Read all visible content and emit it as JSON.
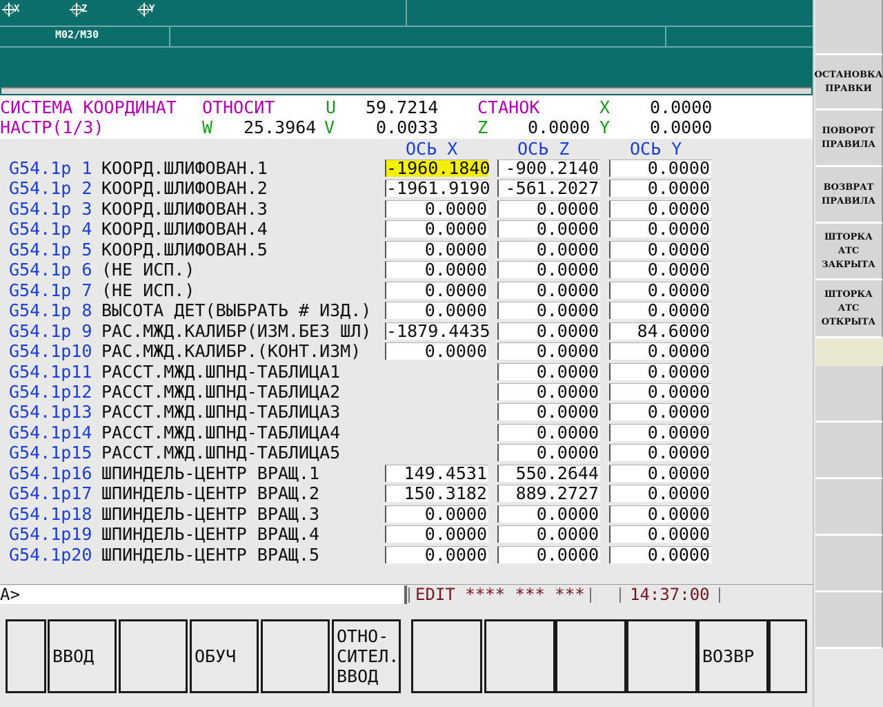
{
  "top": {
    "axes": [
      "X",
      "Z",
      "Y"
    ],
    "mcode": "M02/M30"
  },
  "header": {
    "line1": {
      "title": "СИСТЕМА КООРДИНАТ",
      "mode": "ОТНОСИТ",
      "u_label": "U",
      "u_value": "59.7214",
      "machine_label": "СТАНОК",
      "x_label": "X",
      "x_value": "0.0000"
    },
    "line2": {
      "page": "НАСТР(1/3)",
      "w_label": "W",
      "w_value": "25.3964",
      "v_label": "V",
      "v_value": "0.0033",
      "z_label": "Z",
      "z_value": "0.0000",
      "y_label": "Y",
      "y_value": "0.0000"
    }
  },
  "table": {
    "columns": [
      "ОСЬ X",
      "ОСЬ Z",
      "ОСЬ Y"
    ],
    "rows": [
      {
        "id": "G54.1p 1",
        "name": "КООРД.ШЛИФОВАН.1",
        "x": "-1960.1840",
        "z": "-900.2140",
        "y": "0.0000"
      },
      {
        "id": "G54.1p 2",
        "name": "КООРД.ШЛИФОВАН.2",
        "x": "-1961.9190",
        "z": "-561.2027",
        "y": "0.0000"
      },
      {
        "id": "G54.1p 3",
        "name": "КООРД.ШЛИФОВАН.3",
        "x": "0.0000",
        "z": "0.0000",
        "y": "0.0000"
      },
      {
        "id": "G54.1p 4",
        "name": "КООРД.ШЛИФОВАН.4",
        "x": "0.0000",
        "z": "0.0000",
        "y": "0.0000"
      },
      {
        "id": "G54.1p 5",
        "name": "КООРД.ШЛИФОВАН.5",
        "x": "0.0000",
        "z": "0.0000",
        "y": "0.0000"
      },
      {
        "id": "G54.1p 6",
        "name": "(НЕ ИСП.)",
        "x": "0.0000",
        "z": "0.0000",
        "y": "0.0000"
      },
      {
        "id": "G54.1p 7",
        "name": "(НЕ ИСП.)",
        "x": "0.0000",
        "z": "0.0000",
        "y": "0.0000"
      },
      {
        "id": "G54.1p 8",
        "name": "ВЫСОТА ДЕТ(ВЫБРАТЬ # ИЗД.)",
        "x": "0.0000",
        "z": "0.0000",
        "y": "0.0000"
      },
      {
        "id": "G54.1p 9",
        "name": "РАС.МЖД.КАЛИБР(ИЗМ.БЕЗ ШЛ)",
        "x": "-1879.4435",
        "z": "0.0000",
        "y": "84.6000"
      },
      {
        "id": "G54.1p10",
        "name": "РАС.МЖД.КАЛИБР.(КОНТ.ИЗМ)",
        "x": "0.0000",
        "z": "0.0000",
        "y": "0.0000"
      },
      {
        "id": "G54.1p11",
        "name": "РАССТ.МЖД.ШПНД-ТАБЛИЦА1",
        "x": null,
        "z": "0.0000",
        "y": "0.0000"
      },
      {
        "id": "G54.1p12",
        "name": "РАССТ.МЖД.ШПНД-ТАБЛИЦА2",
        "x": null,
        "z": "0.0000",
        "y": "0.0000"
      },
      {
        "id": "G54.1p13",
        "name": "РАССТ.МЖД.ШПНД-ТАБЛИЦА3",
        "x": null,
        "z": "0.0000",
        "y": "0.0000"
      },
      {
        "id": "G54.1p14",
        "name": "РАССТ.МЖД.ШПНД-ТАБЛИЦА4",
        "x": null,
        "z": "0.0000",
        "y": "0.0000"
      },
      {
        "id": "G54.1p15",
        "name": "РАССТ.МЖД.ШПНД-ТАБЛИЦА5",
        "x": null,
        "z": "0.0000",
        "y": "0.0000"
      },
      {
        "id": "G54.1p16",
        "name": "ШПИНДЕЛЬ-ЦЕНТР ВРАЩ.1",
        "x": "149.4531",
        "z": "550.2644",
        "y": "0.0000"
      },
      {
        "id": "G54.1p17",
        "name": "ШПИНДЕЛЬ-ЦЕНТР ВРАЩ.2",
        "x": "150.3182",
        "z": "889.2727",
        "y": "0.0000"
      },
      {
        "id": "G54.1p18",
        "name": "ШПИНДЕЛЬ-ЦЕНТР ВРАЩ.3",
        "x": "0.0000",
        "z": "0.0000",
        "y": "0.0000"
      },
      {
        "id": "G54.1p19",
        "name": "ШПИНДЕЛЬ-ЦЕНТР ВРАЩ.4",
        "x": "0.0000",
        "z": "0.0000",
        "y": "0.0000"
      },
      {
        "id": "G54.1p20",
        "name": "ШПИНДЕЛЬ-ЦЕНТР ВРАЩ.5",
        "x": "0.0000",
        "z": "0.0000",
        "y": "0.0000"
      }
    ],
    "selected_row": 0,
    "selected_col": "x"
  },
  "status": {
    "prompt": "A>",
    "mode": "EDIT **** *** ***",
    "time": "14:37:00"
  },
  "softkeys": [
    "",
    "ВВОД",
    "",
    "ОБУЧ",
    "",
    "ОТНО-\nСИТЕЛ.\nВВОД",
    "",
    "",
    "",
    "",
    "ВОЗВР",
    ""
  ],
  "side": {
    "buttons": [
      "",
      "ОСТАНОВКА\nПРАВКИ",
      "ПОВОРОТ\nПРАВИЛА",
      "ВОЗВРАТ\nПРАВИЛА",
      "ШТОРКА\nАТС\nЗАКРЫТА",
      "ШТОРКА\nАТС\nОТКРЫТА",
      "",
      "",
      "",
      "",
      ""
    ]
  },
  "colors": {
    "top_band": "#0c6e6a",
    "highlight": "#f4f000",
    "magenta": "#b000b0",
    "green": "#1a9a1a",
    "blue": "#1a3ed6"
  }
}
